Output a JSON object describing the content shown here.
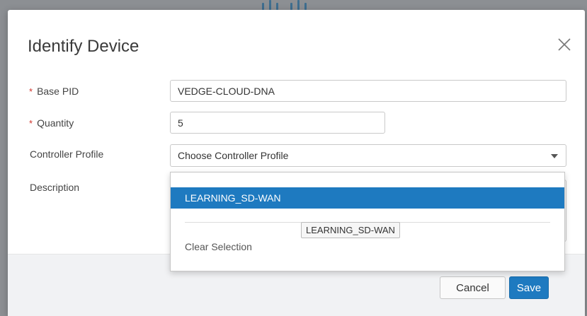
{
  "dialog": {
    "title": "Identify Device",
    "close_icon": "close-icon"
  },
  "fields": {
    "base_pid": {
      "label": "Base PID",
      "required_marker": "*",
      "value": "VEDGE-CLOUD-DNA"
    },
    "quantity": {
      "label": "Quantity",
      "required_marker": "*",
      "value": "5"
    },
    "controller_profile": {
      "label": "Controller Profile",
      "placeholder": "Choose Controller Profile"
    },
    "description": {
      "label": "Description",
      "value": ""
    }
  },
  "dropdown": {
    "options": [
      "LEARNING_SD-WAN"
    ],
    "highlighted": "LEARNING_SD-WAN",
    "clear_label": "Clear Selection"
  },
  "tooltip": {
    "text": "LEARNING_SD-WAN"
  },
  "footer": {
    "cancel_label": "Cancel",
    "save_label": "Save"
  },
  "colors": {
    "accent": "#1e7ac0",
    "required": "#d0342c",
    "overlay": "#8c8f93"
  }
}
